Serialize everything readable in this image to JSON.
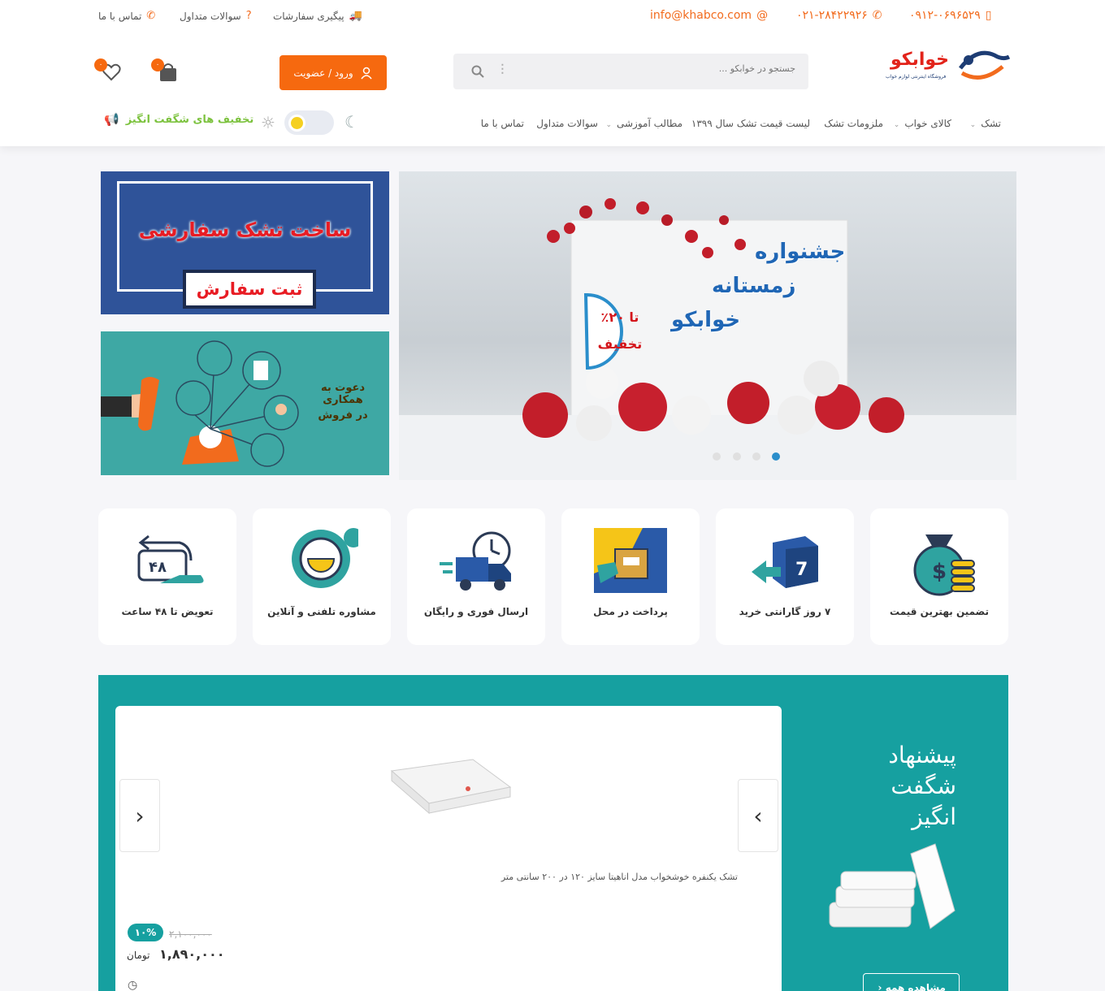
{
  "topbar": {
    "mobile": "۰۹۱۲-۰۶۹۶۵۲۹",
    "phone": "۰۲۱-۲۸۴۲۲۹۲۶",
    "email": "info@khabco.com",
    "order_tracking": "پیگیری سفارشات",
    "faq": "سوالات متداول",
    "contact": "تماس با ما"
  },
  "logo": {
    "name": "خوابکو",
    "tagline": "فروشگاه اینترنتی لوازم خواب"
  },
  "search": {
    "placeholder": "جستجو در خوابکو ..."
  },
  "account": {
    "login_label": "ورود / عضویت",
    "cart_count": "۰",
    "wishlist_count": "۰"
  },
  "nav": {
    "items": [
      {
        "label": "تشک"
      },
      {
        "label": "کالای خواب"
      },
      {
        "label": "ملزومات تشک"
      },
      {
        "label": "لیست قیمت تشک سال ۱۳۹۹"
      },
      {
        "label": "مطالب آموزشی"
      },
      {
        "label": "سوالات متداول"
      },
      {
        "label": "تماس با ما"
      }
    ],
    "promo": "تخفیف های شگفت انگیز"
  },
  "slider": {
    "line1": "جشنواره",
    "line2": "زمستانه",
    "line3": "خوابکو",
    "badge_top": "تا ۲۰٪",
    "badge_bottom": "تخفیف"
  },
  "banner_custom": {
    "title": "ساخت تشک سفارشی",
    "button": "ثبت سفارش"
  },
  "banner_coop": {
    "line1": "دعوت به همکاری",
    "line2": "در فروش"
  },
  "features": [
    {
      "label": "تضمین بهترین قیمت",
      "icon": "money-bag-icon"
    },
    {
      "label": "۷ روز گارانتی خرید",
      "icon": "return-box-icon"
    },
    {
      "label": "پرداخت در محل",
      "icon": "cash-on-delivery-icon"
    },
    {
      "label": "ارسال فوری و رایگان",
      "icon": "fast-truck-icon"
    },
    {
      "label": "مشاوره تلفنی و آنلاین",
      "icon": "consulting-icon"
    },
    {
      "label": "تعویض تا ۴۸ ساعت",
      "icon": "exchange-48-icon"
    }
  ],
  "offer": {
    "title_line1": "پیشنهاد",
    "title_line2": "شگفت",
    "title_line3": "انگیز",
    "see_all": "مشاهده همه",
    "product": {
      "name": "تشک یکنفره خوشخواب مدل اناهیتا سایز ۱۲۰ در ۲۰۰ سانتی متر",
      "old_price": "۲,۱۰۰,۰۰۰",
      "discount": "۱۰%",
      "price": "۱,۸۹۰,۰۰۰",
      "currency": "تومان"
    }
  },
  "colors": {
    "accent": "#f6690f",
    "teal": "#16a0a0",
    "promo_green": "#7cc23e",
    "banner_blue": "#2f5399"
  }
}
